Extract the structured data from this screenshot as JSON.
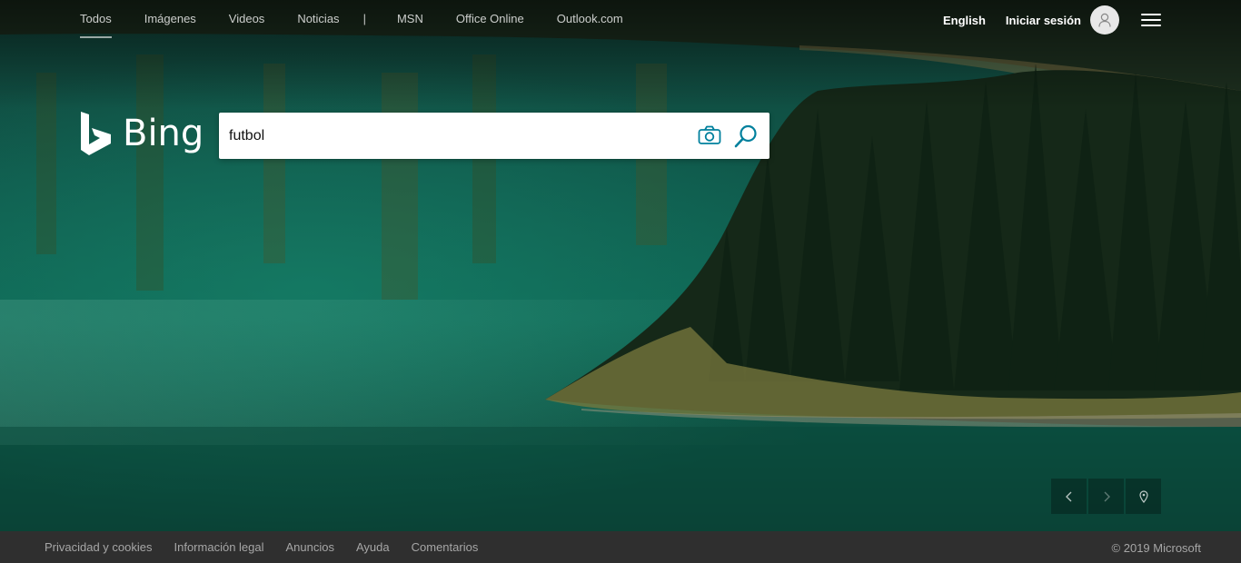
{
  "nav": {
    "items": [
      {
        "label": "Todos",
        "active": true
      },
      {
        "label": "Imágenes"
      },
      {
        "label": "Videos"
      },
      {
        "label": "Noticias"
      },
      {
        "label": "MSN"
      },
      {
        "label": "Office Online"
      },
      {
        "label": "Outlook.com"
      }
    ],
    "separator": "|"
  },
  "header": {
    "language_label": "English",
    "signin_label": "Iniciar sesión",
    "avatar_icon": "user-icon",
    "menu_icon": "hamburger-menu-icon"
  },
  "logo": {
    "wordmark": "Bing",
    "icon": "bing-b-logo-icon"
  },
  "search": {
    "value": "futbol",
    "camera_icon": "camera-icon",
    "search_icon": "search-icon",
    "accent_color": "#00809d"
  },
  "carousel": {
    "prev_icon": "chevron-left-icon",
    "next_icon": "chevron-right-icon",
    "location_icon": "location-pin-icon"
  },
  "footer": {
    "links": [
      "Privacidad y cookies",
      "Información legal",
      "Anuncios",
      "Ayuda",
      "Comentarios"
    ],
    "copyright": "© 2019 Microsoft"
  },
  "colors": {
    "footer_bg": "#2f2f2f",
    "footer_text": "#a6a6a6",
    "water": "#0f5a4c",
    "forest": "#132a1a"
  }
}
